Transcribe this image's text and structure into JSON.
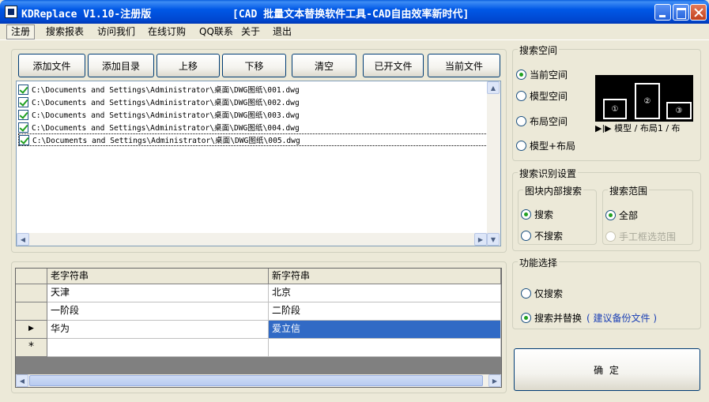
{
  "titlebar": {
    "app_title": "KDReplace V1.10-注册版",
    "subtitle": "[CAD 批量文本替换软件工具-CAD自由效率新时代]"
  },
  "menu": [
    "注册",
    "搜索报表",
    "访问我们",
    "在线订购",
    "QQ联系",
    "关于",
    "退出"
  ],
  "toolbar": {
    "add_file": "添加文件",
    "add_dir": "添加目录",
    "move_up": "上移",
    "move_down": "下移",
    "clear": "清空",
    "opened_files": "已开文件",
    "current_file": "当前文件"
  },
  "files": [
    "C:\\Documents and Settings\\Administrator\\桌面\\DWG图纸\\001.dwg",
    "C:\\Documents and Settings\\Administrator\\桌面\\DWG图纸\\002.dwg",
    "C:\\Documents and Settings\\Administrator\\桌面\\DWG图纸\\003.dwg",
    "C:\\Documents and Settings\\Administrator\\桌面\\DWG图纸\\004.dwg",
    "C:\\Documents and Settings\\Administrator\\桌面\\DWG图纸\\005.dwg"
  ],
  "grid": {
    "headers": [
      "老字符串",
      "新字符串"
    ],
    "rows": [
      {
        "old": "天津",
        "new": "北京"
      },
      {
        "old": "一阶段",
        "new": "二阶段"
      },
      {
        "old": "华为",
        "new": "爱立信"
      }
    ],
    "current_row_marker": "▶",
    "new_row_marker": "*"
  },
  "search_space": {
    "title": "搜索空间",
    "options": [
      "当前空间",
      "模型空间",
      "布局空间",
      "模型+布局"
    ],
    "selected": 0,
    "preview": {
      "boxes": [
        "①",
        "②",
        "③"
      ],
      "tabs": "▶|▶ 模型 / 布局1 / 布"
    }
  },
  "recognition": {
    "title": "搜索识别设置",
    "block_search": {
      "title": "图块内部搜索",
      "options": [
        "搜索",
        "不搜索"
      ],
      "selected": 0
    },
    "range": {
      "title": "搜索范围",
      "options": [
        "全部",
        "手工框选范围"
      ],
      "selected": 0
    }
  },
  "function": {
    "title": "功能选择",
    "options": [
      "仅搜索",
      "搜索并替换"
    ],
    "selected": 1,
    "backup_hint": "( 建议备份文件 )",
    "hint_color": "#1a3fb5"
  },
  "ok_button": "确  定"
}
